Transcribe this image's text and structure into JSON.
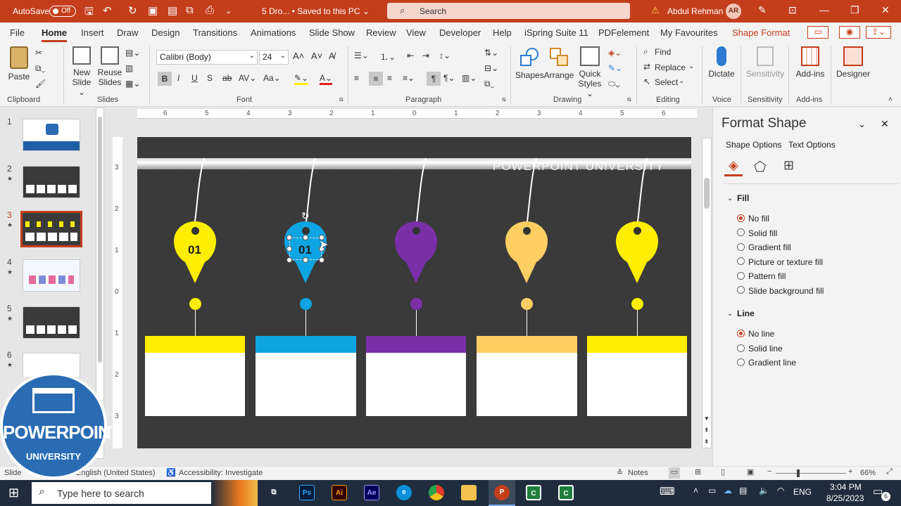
{
  "titlebar": {
    "autosave_label": "AutoSave",
    "autosave_state": "Off",
    "doc_title": "5 Dro... • Saved to this PC ⌄",
    "search_placeholder": "Search",
    "user_name": "Abdul Rehman",
    "user_initials": "AR",
    "accent": "#c43e1c"
  },
  "menu": {
    "items": [
      "File",
      "Home",
      "Insert",
      "Draw",
      "Design",
      "Transitions",
      "Animations",
      "Slide Show",
      "Review",
      "View",
      "Developer",
      "Help",
      "iSpring Suite 11",
      "PDFelement",
      "My Favourites",
      "Shape Format"
    ],
    "active": "Home"
  },
  "ribbon": {
    "clipboard": {
      "paste": "Paste",
      "label": "Clipboard"
    },
    "slides": {
      "new_slide": "New Slide ⌄",
      "reuse": "Reuse Slides",
      "label": "Slides"
    },
    "font": {
      "family": "Calibri (Body)",
      "size": "24",
      "label": "Font"
    },
    "paragraph": {
      "label": "Paragraph"
    },
    "drawing": {
      "shapes": "Shapes",
      "arrange": "Arrange",
      "quick_styles": "Quick Styles ⌄",
      "label": "Drawing"
    },
    "editing": {
      "find": "Find",
      "replace": "Replace",
      "select": "Select",
      "label": "Editing"
    },
    "voice": {
      "dictate": "Dictate",
      "label": "Voice"
    },
    "sensitivity": {
      "btn": "Sensitivity",
      "label": "Sensitivity"
    },
    "addins": {
      "btn": "Add-ins",
      "label": "Add-ins"
    },
    "designer": {
      "btn": "Designer"
    }
  },
  "ruler": {
    "h_ticks": [
      "6",
      "5",
      "4",
      "3",
      "2",
      "1",
      "0",
      "1",
      "2",
      "3",
      "4",
      "5",
      "6"
    ],
    "v_ticks": [
      "3",
      "2",
      "1",
      "0",
      "1",
      "2",
      "3"
    ]
  },
  "thumbnails": [
    {
      "num": "1",
      "star": ""
    },
    {
      "num": "2",
      "star": "★"
    },
    {
      "num": "3",
      "star": "★"
    },
    {
      "num": "4",
      "star": "★"
    },
    {
      "num": "5",
      "star": "★"
    },
    {
      "num": "6",
      "star": "★"
    }
  ],
  "slide": {
    "watermark": "POWERPOINT UNIVERSITY",
    "drops": [
      {
        "color": "#ffee00",
        "label": "01"
      },
      {
        "color": "#0ea5e2",
        "label": "01"
      },
      {
        "color": "#7a2fa8",
        "label": ""
      },
      {
        "color": "#ffce63",
        "label": ""
      },
      {
        "color": "#ffee00",
        "label": ""
      }
    ]
  },
  "format_pane": {
    "title": "Format Shape",
    "tabs": [
      "Shape Options",
      "Text Options"
    ],
    "fill_header": "Fill",
    "fill_options": [
      "No fill",
      "Solid fill",
      "Gradient fill",
      "Picture or texture fill",
      "Pattern fill",
      "Slide background fill"
    ],
    "fill_selected": "No fill",
    "line_header": "Line",
    "line_options": [
      "No line",
      "Solid line",
      "Gradient line"
    ],
    "line_selected": "No line"
  },
  "status": {
    "slide": "Slide",
    "language": "English (United States)",
    "accessibility": "Accessibility: Investigate",
    "notes": "Notes",
    "zoom": "66%"
  },
  "taskbar": {
    "search_placeholder": "Type here to search",
    "lang": "ENG",
    "time": "3:04 PM",
    "date": "8/25/2023",
    "notif_count": "6"
  },
  "logo": {
    "line1": "POWERPOINT",
    "line2": "UNIVERSITY"
  }
}
